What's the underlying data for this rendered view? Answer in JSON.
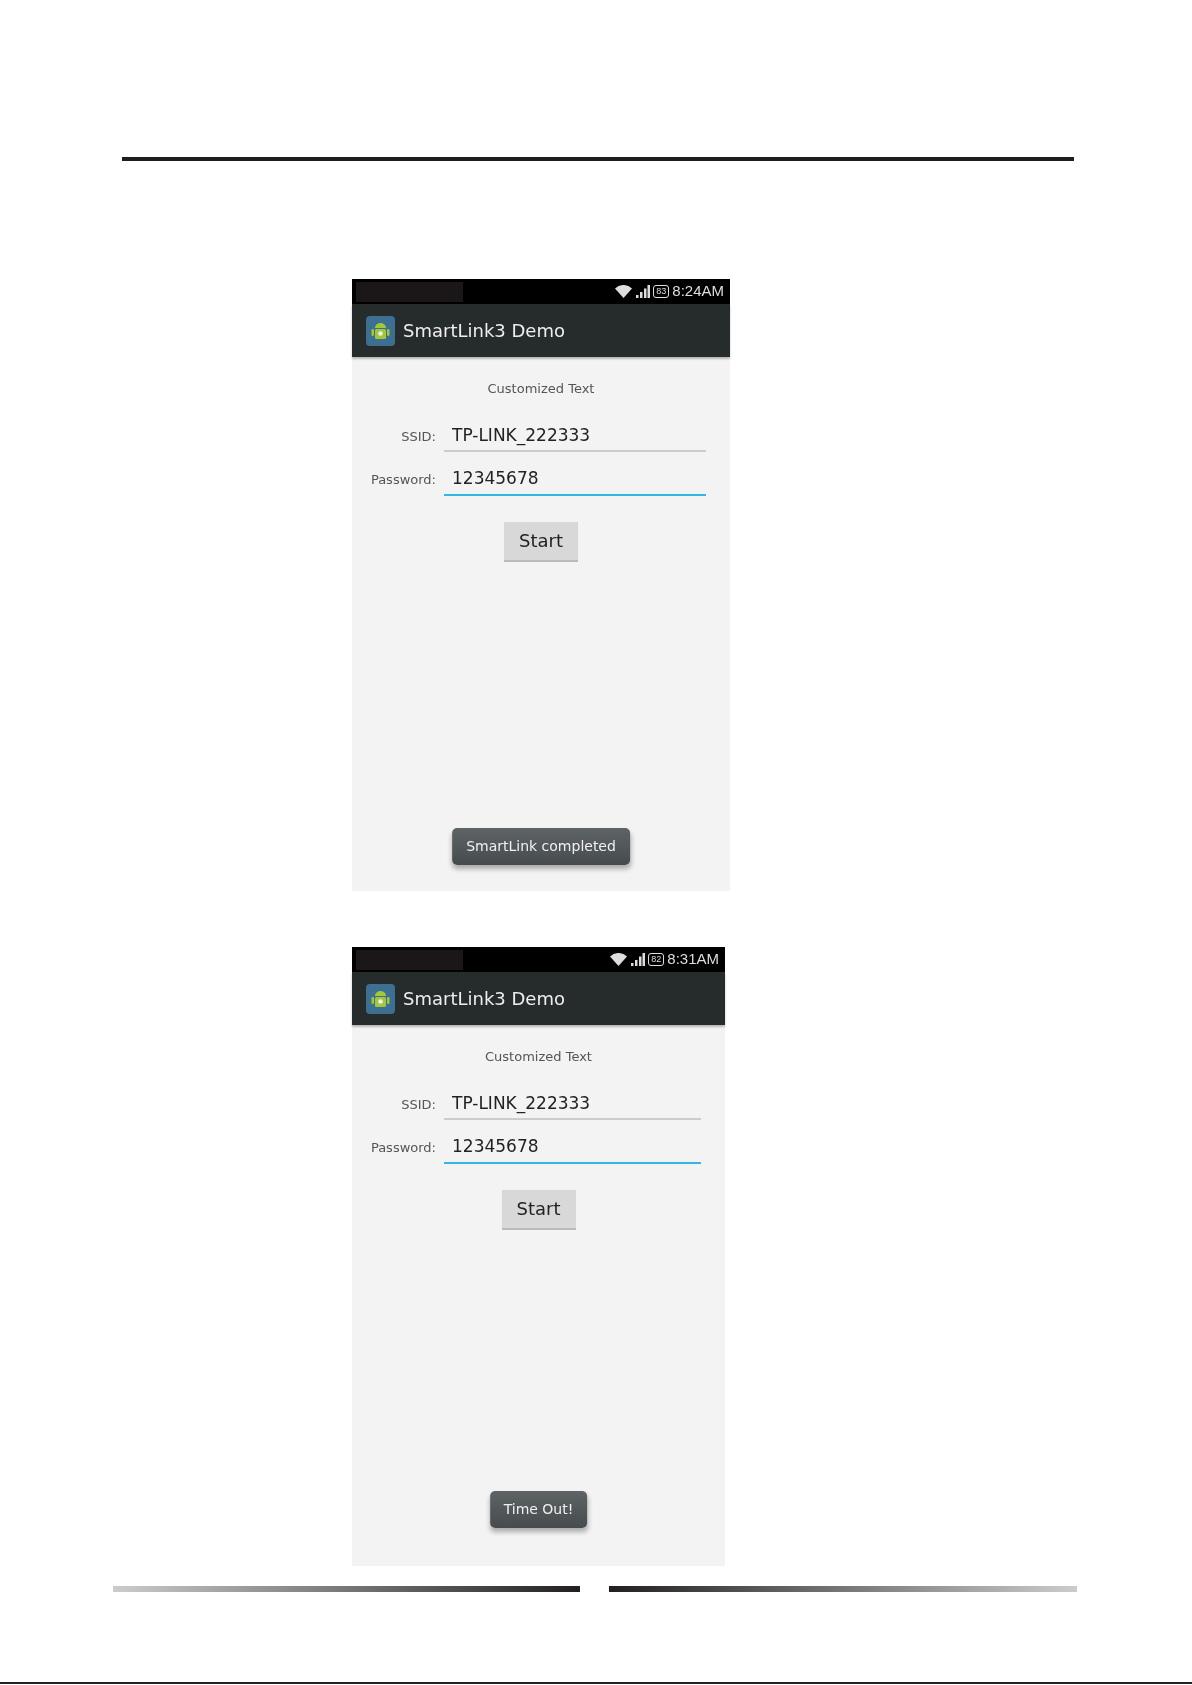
{
  "screens": [
    {
      "status_bar": {
        "battery": "83",
        "time": "8:24AM"
      },
      "title": "SmartLink3 Demo",
      "label": "Customized Text",
      "fields": [
        {
          "label": "SSID:",
          "value": "TP-LINK_222333",
          "focused": false
        },
        {
          "label": "Password:",
          "value": "12345678",
          "focused": true
        }
      ],
      "button": "Start",
      "toast": "SmartLink completed"
    },
    {
      "status_bar": {
        "battery": "82",
        "time": "8:31AM"
      },
      "title": "SmartLink3 Demo",
      "label": "Customized Text",
      "fields": [
        {
          "label": "SSID:",
          "value": "TP-LINK_222333",
          "focused": false
        },
        {
          "label": "Password:",
          "value": "12345678",
          "focused": true
        }
      ],
      "button": "Start",
      "toast": "Time Out!"
    }
  ]
}
